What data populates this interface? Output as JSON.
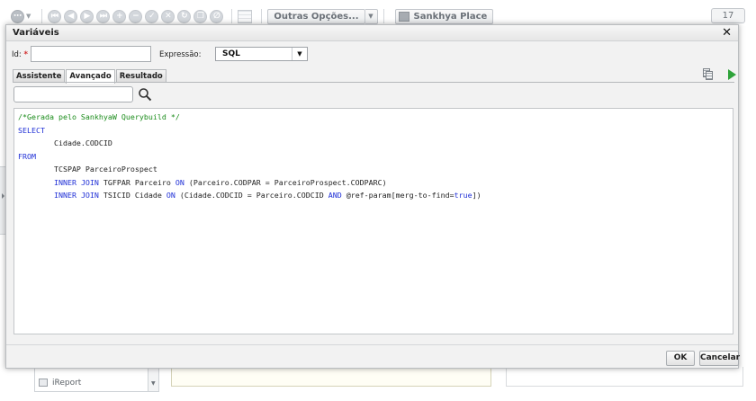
{
  "background": {
    "toolbar": {
      "more_options_label": "Outras Opções...",
      "place_label": "Sankhya Place",
      "counter": "17",
      "icons": [
        "grid-menu-icon",
        "nav-first-icon",
        "nav-prev-icon",
        "nav-next-icon",
        "nav-last-icon",
        "add-icon",
        "remove-icon",
        "confirm-icon",
        "cancel-icon",
        "refresh-icon",
        "copy-icon",
        "attach-icon",
        "table-view-icon"
      ]
    },
    "list_item_label": "iReport"
  },
  "modal": {
    "title": "Variáveis",
    "close_label": "✕",
    "id_label": "Id:",
    "id_required": "*",
    "id_value": "",
    "expression_label": "Expressão:",
    "expression_value": "SQL",
    "tabs": [
      {
        "label": "Assistente",
        "active": false
      },
      {
        "label": "Avançado",
        "active": true
      },
      {
        "label": "Resultado",
        "active": false
      }
    ],
    "search_value": "",
    "code_lines": [
      {
        "parts": [
          {
            "text": "/*Gerada pelo SankhyaW Querybuild */",
            "type": "comment"
          }
        ]
      },
      {
        "parts": [
          {
            "text": "SELECT",
            "type": "kw"
          }
        ]
      },
      {
        "parts": [
          {
            "text": "        Cidade.CODCID",
            "type": "plain"
          }
        ]
      },
      {
        "parts": [
          {
            "text": "FROM",
            "type": "kw"
          }
        ]
      },
      {
        "parts": [
          {
            "text": "        TCSPAP ParceiroProspect",
            "type": "plain"
          }
        ]
      },
      {
        "parts": [
          {
            "text": "        ",
            "type": "plain"
          },
          {
            "text": "INNER JOIN",
            "type": "kw"
          },
          {
            "text": " TGFPAR Parceiro ",
            "type": "plain"
          },
          {
            "text": "ON",
            "type": "kw"
          },
          {
            "text": " (Parceiro.CODPAR = ParceiroProspect.CODPARC)",
            "type": "plain"
          }
        ]
      },
      {
        "parts": [
          {
            "text": "        ",
            "type": "plain"
          },
          {
            "text": "INNER JOIN",
            "type": "kw"
          },
          {
            "text": " TSICID Cidade ",
            "type": "plain"
          },
          {
            "text": "ON",
            "type": "kw"
          },
          {
            "text": " (Cidade.CODCID = Parceiro.CODCID ",
            "type": "plain"
          },
          {
            "text": "AND",
            "type": "kw"
          },
          {
            "text": " @ref-param[merg-to-find=",
            "type": "plain"
          },
          {
            "text": "true",
            "type": "kw"
          },
          {
            "text": "])",
            "type": "plain"
          }
        ]
      }
    ],
    "ok_label": "OK",
    "cancel_label": "Cancelar"
  },
  "colors": {
    "keyword": "#1f2fd6",
    "comment": "#1a8c1a",
    "required": "#d12b2b",
    "run_icon": "#2fa33a"
  }
}
